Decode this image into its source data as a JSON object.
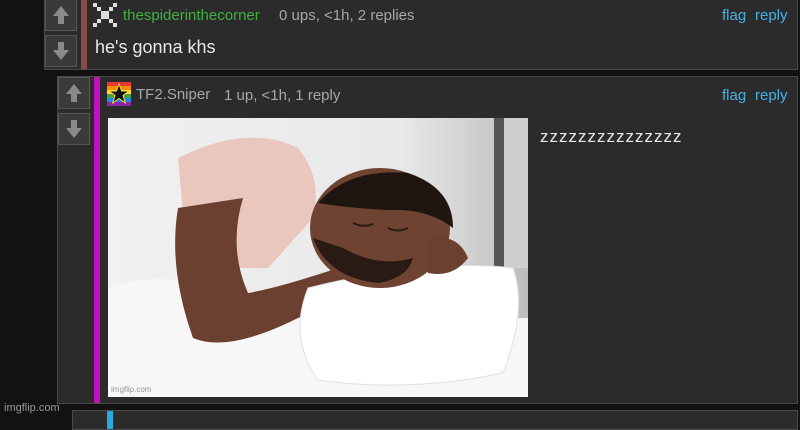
{
  "comment1": {
    "username": "thespiderinthecorner",
    "meta": "0 ups, <1h, 2 replies",
    "flag_label": "flag",
    "reply_label": "reply",
    "text": "he's gonna khs"
  },
  "comment2": {
    "username": "TF2.Sniper",
    "meta": "1 up, <1h, 1 reply",
    "flag_label": "flag",
    "reply_label": "reply",
    "text": "zzzzzzzzzzzzzzz",
    "image_watermark": "imgflip.com"
  },
  "footer": {
    "watermark": "imgflip.com"
  },
  "colors": {
    "username1": "#3fb13f",
    "username2": "#a8a8a8",
    "link": "#3fb3e6",
    "depth_bar_1": "#8b4a4a",
    "depth_bar_2": "#c00ec0",
    "depth_bar_3": "#2aa8e0"
  },
  "icons": {
    "upvote": "arrow-up-icon",
    "downvote": "arrow-down-icon",
    "avatar1": "pixel-spider-avatar-icon",
    "avatar2": "rainbow-star-avatar-icon"
  }
}
